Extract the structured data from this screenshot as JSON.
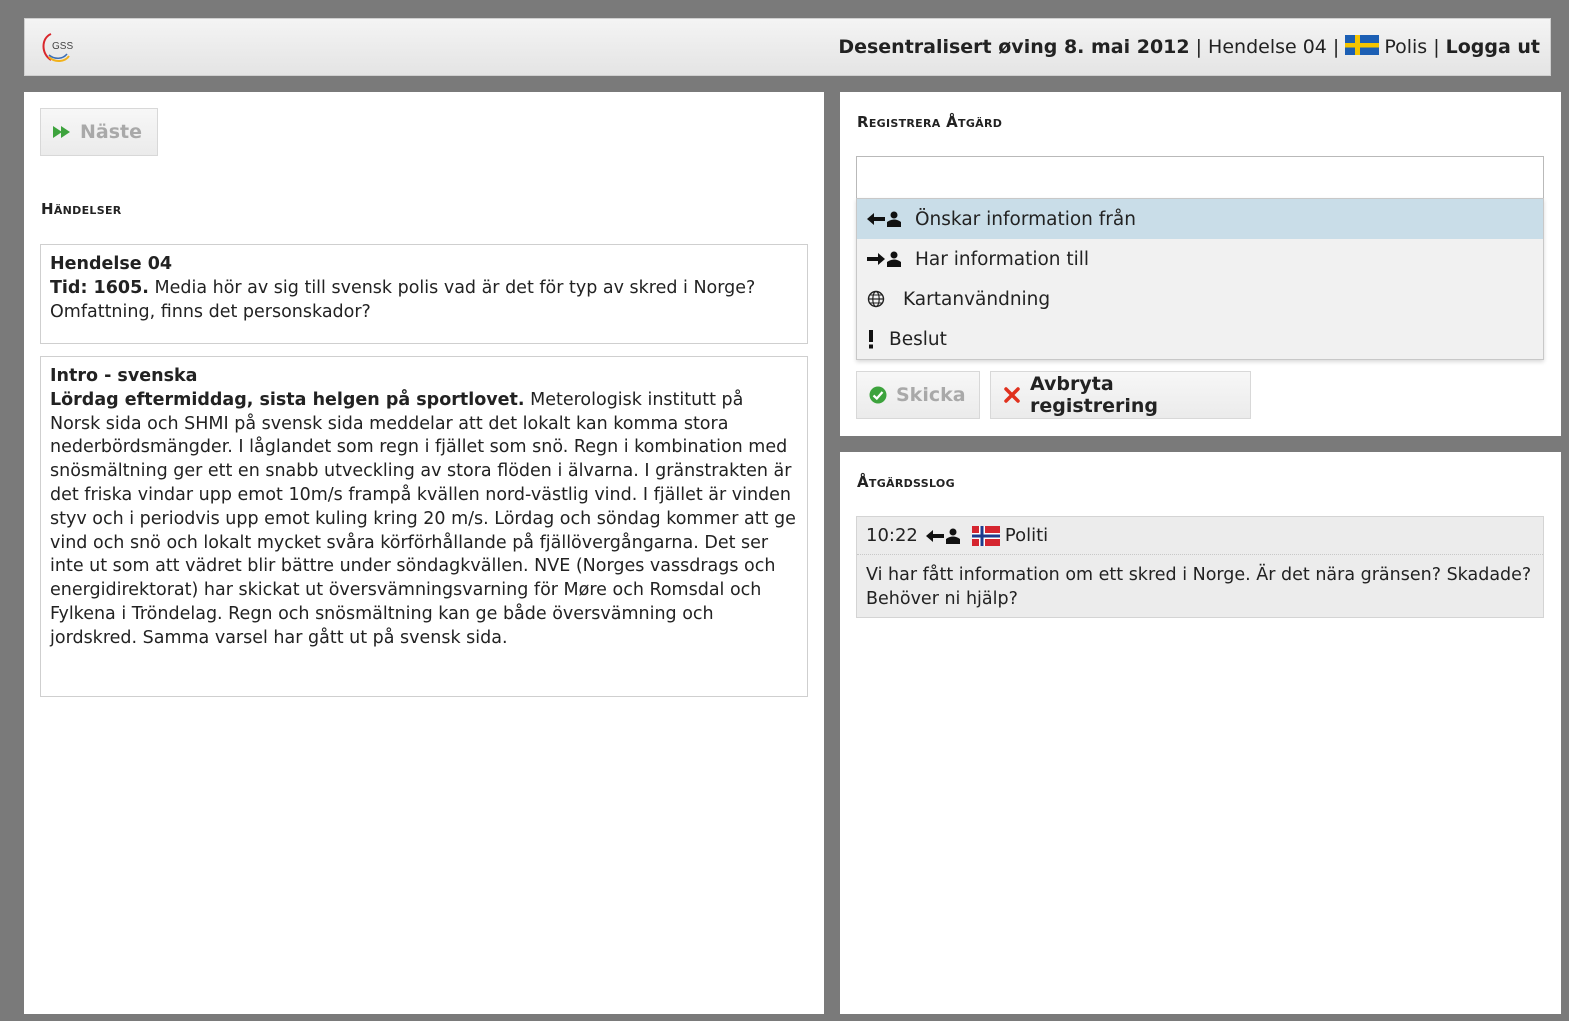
{
  "header": {
    "logo_text": "GSS",
    "exercise": "Desentralisert øving 8. mai 2012",
    "event": "Hendelse 04",
    "role": "Polis",
    "logout": "Logga ut",
    "separator": "|"
  },
  "left": {
    "next_button": "Näste",
    "section_title": "Händelser",
    "events": [
      {
        "title": "Hendelse 04",
        "lead": "Tid: 1605.",
        "body": " Media hör av sig till svensk polis vad är det för typ av skred i Norge? Omfattning, finns det personskador?"
      },
      {
        "title": "Intro - svenska",
        "lead": "Lördag eftermiddag, sista helgen på sportlovet.",
        "body": " Meterologisk institutt på Norsk sida och SHMI på svensk sida meddelar att det lokalt kan komma stora nederbördsmängder. I låglandet som regn i fjället som snö. Regn i kombination med snösmältning ger ett en snabb utveckling av stora flöden i älvarna. I gränstrakten är det friska vindar upp emot 10m/s frampå kvällen nord-västlig vind. I fjället är vinden styv och i periodvis upp emot kuling kring 20 m/s. Lördag och söndag kommer att ge vind och snö och lokalt mycket svåra körförhållande på fjällövergångarna. Det ser inte ut som att vädret blir bättre under söndagkvällen. NVE (Norges vassdrags och energidirektorat) har skickat ut översvämningsvarning för Møre och Romsdal och Fylkena i Tröndelag. Regn och snösmältning kan ge både översvämning och jordskred. Samma varsel har gått ut på svensk sida."
      }
    ]
  },
  "register": {
    "section_title": "Registrera Åtgärd",
    "input_value": "",
    "options": [
      {
        "label": "Önskar information från",
        "icon": "request-info-icon",
        "selected": true
      },
      {
        "label": "Har information till",
        "icon": "provide-info-icon",
        "selected": false
      },
      {
        "label": "Kartanvändning",
        "icon": "globe-icon",
        "selected": false
      },
      {
        "label": "Beslut",
        "icon": "exclamation-icon",
        "selected": false
      }
    ],
    "send_button": "Skicka",
    "cancel_button": "Avbryta registrering"
  },
  "log": {
    "section_title": "Åtgärdsslog",
    "entries": [
      {
        "time": "10:22",
        "direction_icon": "request-info-icon",
        "flag": "norway-flag-icon",
        "party": "Politi",
        "text": "Vi har fått information om ett skred i Norge. Är det nära gränsen? Skadade? Behöver ni hjälp?"
      }
    ]
  },
  "colors": {
    "background": "#7a7a7a",
    "selected_option": "#c9dde8",
    "cancel_x": "#e0311e",
    "check_green": "#3da33d"
  }
}
